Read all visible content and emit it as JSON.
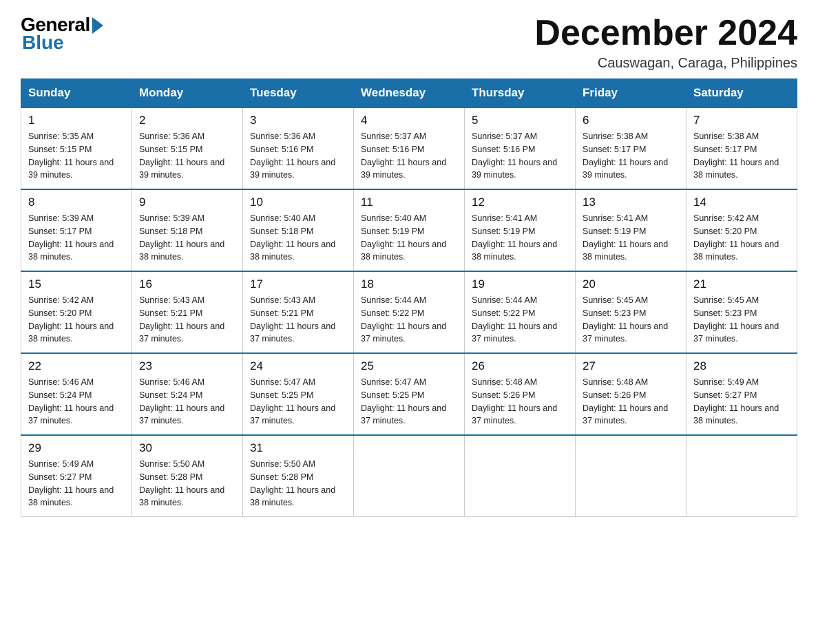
{
  "logo": {
    "general": "General",
    "blue": "Blue"
  },
  "header": {
    "month_year": "December 2024",
    "subtitle": "Causwagan, Caraga, Philippines"
  },
  "days_of_week": [
    "Sunday",
    "Monday",
    "Tuesday",
    "Wednesday",
    "Thursday",
    "Friday",
    "Saturday"
  ],
  "weeks": [
    [
      {
        "day": "1",
        "sunrise": "5:35 AM",
        "sunset": "5:15 PM",
        "daylight": "11 hours and 39 minutes."
      },
      {
        "day": "2",
        "sunrise": "5:36 AM",
        "sunset": "5:15 PM",
        "daylight": "11 hours and 39 minutes."
      },
      {
        "day": "3",
        "sunrise": "5:36 AM",
        "sunset": "5:16 PM",
        "daylight": "11 hours and 39 minutes."
      },
      {
        "day": "4",
        "sunrise": "5:37 AM",
        "sunset": "5:16 PM",
        "daylight": "11 hours and 39 minutes."
      },
      {
        "day": "5",
        "sunrise": "5:37 AM",
        "sunset": "5:16 PM",
        "daylight": "11 hours and 39 minutes."
      },
      {
        "day": "6",
        "sunrise": "5:38 AM",
        "sunset": "5:17 PM",
        "daylight": "11 hours and 39 minutes."
      },
      {
        "day": "7",
        "sunrise": "5:38 AM",
        "sunset": "5:17 PM",
        "daylight": "11 hours and 38 minutes."
      }
    ],
    [
      {
        "day": "8",
        "sunrise": "5:39 AM",
        "sunset": "5:17 PM",
        "daylight": "11 hours and 38 minutes."
      },
      {
        "day": "9",
        "sunrise": "5:39 AM",
        "sunset": "5:18 PM",
        "daylight": "11 hours and 38 minutes."
      },
      {
        "day": "10",
        "sunrise": "5:40 AM",
        "sunset": "5:18 PM",
        "daylight": "11 hours and 38 minutes."
      },
      {
        "day": "11",
        "sunrise": "5:40 AM",
        "sunset": "5:19 PM",
        "daylight": "11 hours and 38 minutes."
      },
      {
        "day": "12",
        "sunrise": "5:41 AM",
        "sunset": "5:19 PM",
        "daylight": "11 hours and 38 minutes."
      },
      {
        "day": "13",
        "sunrise": "5:41 AM",
        "sunset": "5:19 PM",
        "daylight": "11 hours and 38 minutes."
      },
      {
        "day": "14",
        "sunrise": "5:42 AM",
        "sunset": "5:20 PM",
        "daylight": "11 hours and 38 minutes."
      }
    ],
    [
      {
        "day": "15",
        "sunrise": "5:42 AM",
        "sunset": "5:20 PM",
        "daylight": "11 hours and 38 minutes."
      },
      {
        "day": "16",
        "sunrise": "5:43 AM",
        "sunset": "5:21 PM",
        "daylight": "11 hours and 37 minutes."
      },
      {
        "day": "17",
        "sunrise": "5:43 AM",
        "sunset": "5:21 PM",
        "daylight": "11 hours and 37 minutes."
      },
      {
        "day": "18",
        "sunrise": "5:44 AM",
        "sunset": "5:22 PM",
        "daylight": "11 hours and 37 minutes."
      },
      {
        "day": "19",
        "sunrise": "5:44 AM",
        "sunset": "5:22 PM",
        "daylight": "11 hours and 37 minutes."
      },
      {
        "day": "20",
        "sunrise": "5:45 AM",
        "sunset": "5:23 PM",
        "daylight": "11 hours and 37 minutes."
      },
      {
        "day": "21",
        "sunrise": "5:45 AM",
        "sunset": "5:23 PM",
        "daylight": "11 hours and 37 minutes."
      }
    ],
    [
      {
        "day": "22",
        "sunrise": "5:46 AM",
        "sunset": "5:24 PM",
        "daylight": "11 hours and 37 minutes."
      },
      {
        "day": "23",
        "sunrise": "5:46 AM",
        "sunset": "5:24 PM",
        "daylight": "11 hours and 37 minutes."
      },
      {
        "day": "24",
        "sunrise": "5:47 AM",
        "sunset": "5:25 PM",
        "daylight": "11 hours and 37 minutes."
      },
      {
        "day": "25",
        "sunrise": "5:47 AM",
        "sunset": "5:25 PM",
        "daylight": "11 hours and 37 minutes."
      },
      {
        "day": "26",
        "sunrise": "5:48 AM",
        "sunset": "5:26 PM",
        "daylight": "11 hours and 37 minutes."
      },
      {
        "day": "27",
        "sunrise": "5:48 AM",
        "sunset": "5:26 PM",
        "daylight": "11 hours and 37 minutes."
      },
      {
        "day": "28",
        "sunrise": "5:49 AM",
        "sunset": "5:27 PM",
        "daylight": "11 hours and 38 minutes."
      }
    ],
    [
      {
        "day": "29",
        "sunrise": "5:49 AM",
        "sunset": "5:27 PM",
        "daylight": "11 hours and 38 minutes."
      },
      {
        "day": "30",
        "sunrise": "5:50 AM",
        "sunset": "5:28 PM",
        "daylight": "11 hours and 38 minutes."
      },
      {
        "day": "31",
        "sunrise": "5:50 AM",
        "sunset": "5:28 PM",
        "daylight": "11 hours and 38 minutes."
      },
      null,
      null,
      null,
      null
    ]
  ]
}
